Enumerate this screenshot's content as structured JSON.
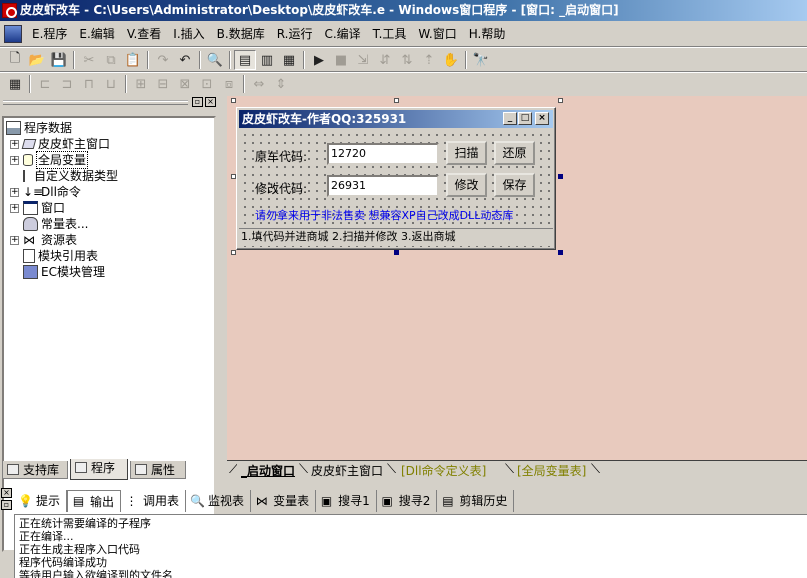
{
  "window": {
    "title": "皮皮虾改车 - C:\\Users\\Administrator\\Desktop\\皮皮虾改车.e - Windows窗口程序 - [窗口: _启动窗口]"
  },
  "menu": [
    {
      "label": "E.程序"
    },
    {
      "label": "E.编辑"
    },
    {
      "label": "V.查看"
    },
    {
      "label": "I.插入"
    },
    {
      "label": "B.数据库"
    },
    {
      "label": "R.运行"
    },
    {
      "label": "C.编译"
    },
    {
      "label": "T.工具"
    },
    {
      "label": "W.窗口"
    },
    {
      "label": "H.帮助"
    }
  ],
  "toolbar1": [
    {
      "icon": "new-file-icon",
      "glyph": "🗋"
    },
    {
      "icon": "open-folder-icon",
      "glyph": "📂"
    },
    {
      "icon": "save-icon",
      "glyph": "💾"
    },
    {
      "icon": "cut-icon",
      "glyph": "✂",
      "disabled": true
    },
    {
      "icon": "copy-icon",
      "glyph": "⧉",
      "disabled": true
    },
    {
      "icon": "paste-icon",
      "glyph": "📋"
    },
    {
      "icon": "redo-icon",
      "glyph": "↷",
      "disabled": true
    },
    {
      "icon": "undo-icon",
      "glyph": "↶"
    },
    {
      "icon": "find-icon",
      "glyph": "🔍"
    },
    {
      "icon": "layout-view-1-icon",
      "glyph": "▤",
      "active": true
    },
    {
      "icon": "layout-view-2-icon",
      "glyph": "▥"
    },
    {
      "icon": "layout-view-3-icon",
      "glyph": "▦"
    },
    {
      "icon": "run-icon",
      "glyph": "▶"
    },
    {
      "icon": "stop-icon",
      "glyph": "■",
      "disabled": true
    },
    {
      "icon": "step-icon",
      "glyph": "⇲",
      "disabled": true
    },
    {
      "icon": "step-into-icon",
      "glyph": "⇵",
      "disabled": true
    },
    {
      "icon": "step-over-icon",
      "glyph": "⇅",
      "disabled": true
    },
    {
      "icon": "step-out-icon",
      "glyph": "⇡",
      "disabled": true
    },
    {
      "icon": "pause-icon",
      "glyph": "✋",
      "disabled": true
    },
    {
      "icon": "binoculars-icon",
      "glyph": "🔭"
    }
  ],
  "toolbar2": [
    {
      "icon": "form-grid-icon",
      "glyph": "▦"
    },
    {
      "icon": "align-left-icon",
      "glyph": "⊏",
      "disabled": true
    },
    {
      "icon": "align-right-icon",
      "glyph": "⊐",
      "disabled": true
    },
    {
      "icon": "align-top-icon",
      "glyph": "⊓",
      "disabled": true
    },
    {
      "icon": "align-bottom-icon",
      "glyph": "⊔",
      "disabled": true
    },
    {
      "icon": "center-h-icon",
      "glyph": "⊞",
      "disabled": true
    },
    {
      "icon": "center-v-icon",
      "glyph": "⊟",
      "disabled": true
    },
    {
      "icon": "same-width-icon",
      "glyph": "⊠",
      "disabled": true
    },
    {
      "icon": "same-height-icon",
      "glyph": "⊡",
      "disabled": true
    },
    {
      "icon": "same-size-icon",
      "glyph": "⧈",
      "disabled": true
    },
    {
      "icon": "space-h-icon",
      "glyph": "⇔",
      "disabled": true
    },
    {
      "icon": "space-v-icon",
      "glyph": "⇕",
      "disabled": true
    }
  ],
  "tree": {
    "root": "程序数据",
    "items": [
      {
        "label": "皮皮虾主窗口",
        "expander": "+",
        "indent": 0
      },
      {
        "label": "全局变量",
        "expander": "+",
        "indent": 0,
        "selected": true
      },
      {
        "label": "自定义数据类型",
        "expander": "",
        "indent": 0
      },
      {
        "label": "Dll命令",
        "expander": "+",
        "indent": 0
      },
      {
        "label": "窗口",
        "expander": "+",
        "indent": 0
      },
      {
        "label": "常量表...",
        "expander": "",
        "indent": 0
      },
      {
        "label": "资源表",
        "expander": "+",
        "indent": 0
      },
      {
        "label": "模块引用表",
        "expander": "",
        "indent": 0
      },
      {
        "label": "EC模块管理",
        "expander": "",
        "indent": 0
      }
    ]
  },
  "left_tabs": {
    "support": "支持库",
    "program": "程序",
    "property": "属性"
  },
  "form": {
    "title": "皮皮虾改车-作者QQ:325931",
    "original_label": "原车代码:",
    "original_value": "12720",
    "modified_label": "修改代码:",
    "modified_value": "26931",
    "scan_btn": "扫描",
    "restore_btn": "还原",
    "modify_btn": "修改",
    "save_btn": "保存",
    "warning": "请勿拿来用于非法售卖  想兼容XP自己改成DLL动态库",
    "status": "1.填代码并进商城   2.扫描并修改   3.返出商城"
  },
  "doc_tabs": [
    {
      "label": "_启动窗口",
      "active": true
    },
    {
      "label": "皮皮虾主窗口"
    },
    {
      "label": "[Dll命令定义表]"
    },
    {
      "label": "[全局变量表]"
    }
  ],
  "bottom_tabs": [
    {
      "label": "提示",
      "icon": "hint-icon",
      "glyph": "💡"
    },
    {
      "label": "输出",
      "icon": "output-icon",
      "glyph": "▤",
      "active": true
    },
    {
      "label": "调用表",
      "icon": "call-table-icon",
      "glyph": "⋮"
    },
    {
      "label": "监视表",
      "icon": "watch-icon",
      "glyph": "🔍"
    },
    {
      "label": "变量表",
      "icon": "variable-icon",
      "glyph": "⋈"
    },
    {
      "label": "搜寻1",
      "icon": "search1-icon",
      "glyph": "▣"
    },
    {
      "label": "搜寻2",
      "icon": "search2-icon",
      "glyph": "▣"
    },
    {
      "label": "剪辑历史",
      "icon": "clip-history-icon",
      "glyph": "▤"
    }
  ],
  "output_lines": [
    "正在统计需要编译的子程序",
    "正在编译...",
    "正在生成主程序入口代码",
    "程序代码编译成功",
    "等待用户输入欲编译到的文件名"
  ]
}
